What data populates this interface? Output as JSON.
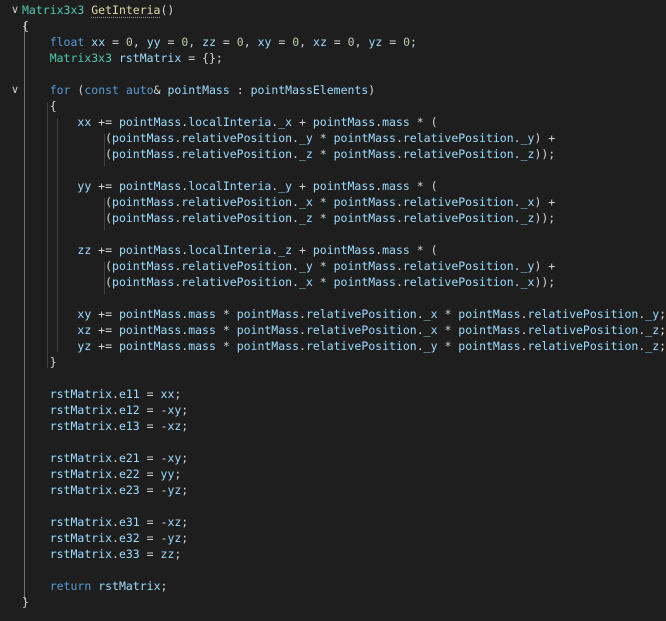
{
  "colors": {
    "background": "#1e1e1e",
    "keyword": "#569cd6",
    "type": "#4ec9b0",
    "function": "#dcdcaa",
    "variable": "#9cdcfe",
    "number": "#b5cea8",
    "text": "#d4d4d4"
  },
  "icons": {
    "fold": "chevron-down-icon"
  },
  "lines": [
    {
      "fold": true,
      "tokens": [
        [
          "ty",
          "Matrix3x3"
        ],
        [
          "op",
          " "
        ],
        [
          "fn",
          "GetInteria"
        ],
        [
          "op",
          "()"
        ]
      ]
    },
    {
      "tokens": [
        [
          "op",
          "{"
        ]
      ]
    },
    {
      "tokens": [
        [
          "op",
          "    "
        ],
        [
          "kw",
          "float"
        ],
        [
          "op",
          " "
        ],
        [
          "var",
          "xx"
        ],
        [
          "op",
          " = "
        ],
        [
          "num",
          "0"
        ],
        [
          "op",
          ", "
        ],
        [
          "var",
          "yy"
        ],
        [
          "op",
          " = "
        ],
        [
          "num",
          "0"
        ],
        [
          "op",
          ", "
        ],
        [
          "var",
          "zz"
        ],
        [
          "op",
          " = "
        ],
        [
          "num",
          "0"
        ],
        [
          "op",
          ", "
        ],
        [
          "var",
          "xy"
        ],
        [
          "op",
          " = "
        ],
        [
          "num",
          "0"
        ],
        [
          "op",
          ", "
        ],
        [
          "var",
          "xz"
        ],
        [
          "op",
          " = "
        ],
        [
          "num",
          "0"
        ],
        [
          "op",
          ", "
        ],
        [
          "var",
          "yz"
        ],
        [
          "op",
          " = "
        ],
        [
          "num",
          "0"
        ],
        [
          "op",
          ";"
        ]
      ]
    },
    {
      "tokens": [
        [
          "op",
          "    "
        ],
        [
          "ty",
          "Matrix3x3"
        ],
        [
          "op",
          " "
        ],
        [
          "var",
          "rstMatrix"
        ],
        [
          "op",
          " = {};"
        ]
      ]
    },
    {
      "tokens": []
    },
    {
      "fold": true,
      "tokens": [
        [
          "op",
          "    "
        ],
        [
          "kw",
          "for"
        ],
        [
          "op",
          " ("
        ],
        [
          "kw",
          "const"
        ],
        [
          "op",
          " "
        ],
        [
          "kw",
          "auto"
        ],
        [
          "op",
          "& "
        ],
        [
          "var",
          "pointMass"
        ],
        [
          "op",
          " : "
        ],
        [
          "var",
          "pointMassElements"
        ],
        [
          "op",
          ")"
        ]
      ]
    },
    {
      "tokens": [
        [
          "op",
          "    {"
        ]
      ]
    },
    {
      "tokens": [
        [
          "op",
          "        "
        ],
        [
          "var",
          "xx"
        ],
        [
          "op",
          " += "
        ],
        [
          "var",
          "pointMass"
        ],
        [
          "op",
          "."
        ],
        [
          "var",
          "localInteria"
        ],
        [
          "op",
          "."
        ],
        [
          "var",
          "_x"
        ],
        [
          "op",
          " + "
        ],
        [
          "var",
          "pointMass"
        ],
        [
          "op",
          "."
        ],
        [
          "var",
          "mass"
        ],
        [
          "op",
          " * ("
        ]
      ]
    },
    {
      "tokens": [
        [
          "op",
          "            ("
        ],
        [
          "var",
          "pointMass"
        ],
        [
          "op",
          "."
        ],
        [
          "var",
          "relativePosition"
        ],
        [
          "op",
          "."
        ],
        [
          "var",
          "_y"
        ],
        [
          "op",
          " * "
        ],
        [
          "var",
          "pointMass"
        ],
        [
          "op",
          "."
        ],
        [
          "var",
          "relativePosition"
        ],
        [
          "op",
          "."
        ],
        [
          "var",
          "_y"
        ],
        [
          "op",
          ") +"
        ]
      ]
    },
    {
      "tokens": [
        [
          "op",
          "            ("
        ],
        [
          "var",
          "pointMass"
        ],
        [
          "op",
          "."
        ],
        [
          "var",
          "relativePosition"
        ],
        [
          "op",
          "."
        ],
        [
          "var",
          "_z"
        ],
        [
          "op",
          " * "
        ],
        [
          "var",
          "pointMass"
        ],
        [
          "op",
          "."
        ],
        [
          "var",
          "relativePosition"
        ],
        [
          "op",
          "."
        ],
        [
          "var",
          "_z"
        ],
        [
          "op",
          "));"
        ]
      ]
    },
    {
      "tokens": []
    },
    {
      "tokens": [
        [
          "op",
          "        "
        ],
        [
          "var",
          "yy"
        ],
        [
          "op",
          " += "
        ],
        [
          "var",
          "pointMass"
        ],
        [
          "op",
          "."
        ],
        [
          "var",
          "localInteria"
        ],
        [
          "op",
          "."
        ],
        [
          "var",
          "_y"
        ],
        [
          "op",
          " + "
        ],
        [
          "var",
          "pointMass"
        ],
        [
          "op",
          "."
        ],
        [
          "var",
          "mass"
        ],
        [
          "op",
          " * ("
        ]
      ]
    },
    {
      "tokens": [
        [
          "op",
          "            ("
        ],
        [
          "var",
          "pointMass"
        ],
        [
          "op",
          "."
        ],
        [
          "var",
          "relativePosition"
        ],
        [
          "op",
          "."
        ],
        [
          "var",
          "_x"
        ],
        [
          "op",
          " * "
        ],
        [
          "var",
          "pointMass"
        ],
        [
          "op",
          "."
        ],
        [
          "var",
          "relativePosition"
        ],
        [
          "op",
          "."
        ],
        [
          "var",
          "_x"
        ],
        [
          "op",
          ") +"
        ]
      ]
    },
    {
      "tokens": [
        [
          "op",
          "            ("
        ],
        [
          "var",
          "pointMass"
        ],
        [
          "op",
          "."
        ],
        [
          "var",
          "relativePosition"
        ],
        [
          "op",
          "."
        ],
        [
          "var",
          "_z"
        ],
        [
          "op",
          " * "
        ],
        [
          "var",
          "pointMass"
        ],
        [
          "op",
          "."
        ],
        [
          "var",
          "relativePosition"
        ],
        [
          "op",
          "."
        ],
        [
          "var",
          "_z"
        ],
        [
          "op",
          "));"
        ]
      ]
    },
    {
      "tokens": []
    },
    {
      "tokens": [
        [
          "op",
          "        "
        ],
        [
          "var",
          "zz"
        ],
        [
          "op",
          " += "
        ],
        [
          "var",
          "pointMass"
        ],
        [
          "op",
          "."
        ],
        [
          "var",
          "localInteria"
        ],
        [
          "op",
          "."
        ],
        [
          "var",
          "_z"
        ],
        [
          "op",
          " + "
        ],
        [
          "var",
          "pointMass"
        ],
        [
          "op",
          "."
        ],
        [
          "var",
          "mass"
        ],
        [
          "op",
          " * ("
        ]
      ]
    },
    {
      "tokens": [
        [
          "op",
          "            ("
        ],
        [
          "var",
          "pointMass"
        ],
        [
          "op",
          "."
        ],
        [
          "var",
          "relativePosition"
        ],
        [
          "op",
          "."
        ],
        [
          "var",
          "_y"
        ],
        [
          "op",
          " * "
        ],
        [
          "var",
          "pointMass"
        ],
        [
          "op",
          "."
        ],
        [
          "var",
          "relativePosition"
        ],
        [
          "op",
          "."
        ],
        [
          "var",
          "_y"
        ],
        [
          "op",
          ") +"
        ]
      ]
    },
    {
      "tokens": [
        [
          "op",
          "            ("
        ],
        [
          "var",
          "pointMass"
        ],
        [
          "op",
          "."
        ],
        [
          "var",
          "relativePosition"
        ],
        [
          "op",
          "."
        ],
        [
          "var",
          "_x"
        ],
        [
          "op",
          " * "
        ],
        [
          "var",
          "pointMass"
        ],
        [
          "op",
          "."
        ],
        [
          "var",
          "relativePosition"
        ],
        [
          "op",
          "."
        ],
        [
          "var",
          "_x"
        ],
        [
          "op",
          "));"
        ]
      ]
    },
    {
      "tokens": []
    },
    {
      "tokens": [
        [
          "op",
          "        "
        ],
        [
          "var",
          "xy"
        ],
        [
          "op",
          " += "
        ],
        [
          "var",
          "pointMass"
        ],
        [
          "op",
          "."
        ],
        [
          "var",
          "mass"
        ],
        [
          "op",
          " * "
        ],
        [
          "var",
          "pointMass"
        ],
        [
          "op",
          "."
        ],
        [
          "var",
          "relativePosition"
        ],
        [
          "op",
          "."
        ],
        [
          "var",
          "_x"
        ],
        [
          "op",
          " * "
        ],
        [
          "var",
          "pointMass"
        ],
        [
          "op",
          "."
        ],
        [
          "var",
          "relativePosition"
        ],
        [
          "op",
          "."
        ],
        [
          "var",
          "_y"
        ],
        [
          "op",
          ";"
        ]
      ]
    },
    {
      "tokens": [
        [
          "op",
          "        "
        ],
        [
          "var",
          "xz"
        ],
        [
          "op",
          " += "
        ],
        [
          "var",
          "pointMass"
        ],
        [
          "op",
          "."
        ],
        [
          "var",
          "mass"
        ],
        [
          "op",
          " * "
        ],
        [
          "var",
          "pointMass"
        ],
        [
          "op",
          "."
        ],
        [
          "var",
          "relativePosition"
        ],
        [
          "op",
          "."
        ],
        [
          "var",
          "_x"
        ],
        [
          "op",
          " * "
        ],
        [
          "var",
          "pointMass"
        ],
        [
          "op",
          "."
        ],
        [
          "var",
          "relativePosition"
        ],
        [
          "op",
          "."
        ],
        [
          "var",
          "_z"
        ],
        [
          "op",
          ";"
        ]
      ]
    },
    {
      "tokens": [
        [
          "op",
          "        "
        ],
        [
          "var",
          "yz"
        ],
        [
          "op",
          " += "
        ],
        [
          "var",
          "pointMass"
        ],
        [
          "op",
          "."
        ],
        [
          "var",
          "mass"
        ],
        [
          "op",
          " * "
        ],
        [
          "var",
          "pointMass"
        ],
        [
          "op",
          "."
        ],
        [
          "var",
          "relativePosition"
        ],
        [
          "op",
          "."
        ],
        [
          "var",
          "_y"
        ],
        [
          "op",
          " * "
        ],
        [
          "var",
          "pointMass"
        ],
        [
          "op",
          "."
        ],
        [
          "var",
          "relativePosition"
        ],
        [
          "op",
          "."
        ],
        [
          "var",
          "_z"
        ],
        [
          "op",
          ";"
        ]
      ]
    },
    {
      "tokens": [
        [
          "op",
          "    }"
        ]
      ]
    },
    {
      "tokens": []
    },
    {
      "tokens": [
        [
          "op",
          "    "
        ],
        [
          "var",
          "rstMatrix"
        ],
        [
          "op",
          "."
        ],
        [
          "var",
          "e11"
        ],
        [
          "op",
          " = "
        ],
        [
          "var",
          "xx"
        ],
        [
          "op",
          ";"
        ]
      ]
    },
    {
      "tokens": [
        [
          "op",
          "    "
        ],
        [
          "var",
          "rstMatrix"
        ],
        [
          "op",
          "."
        ],
        [
          "var",
          "e12"
        ],
        [
          "op",
          " = -"
        ],
        [
          "var",
          "xy"
        ],
        [
          "op",
          ";"
        ]
      ]
    },
    {
      "tokens": [
        [
          "op",
          "    "
        ],
        [
          "var",
          "rstMatrix"
        ],
        [
          "op",
          "."
        ],
        [
          "var",
          "e13"
        ],
        [
          "op",
          " = -"
        ],
        [
          "var",
          "xz"
        ],
        [
          "op",
          ";"
        ]
      ]
    },
    {
      "tokens": []
    },
    {
      "tokens": [
        [
          "op",
          "    "
        ],
        [
          "var",
          "rstMatrix"
        ],
        [
          "op",
          "."
        ],
        [
          "var",
          "e21"
        ],
        [
          "op",
          " = -"
        ],
        [
          "var",
          "xy"
        ],
        [
          "op",
          ";"
        ]
      ]
    },
    {
      "tokens": [
        [
          "op",
          "    "
        ],
        [
          "var",
          "rstMatrix"
        ],
        [
          "op",
          "."
        ],
        [
          "var",
          "e22"
        ],
        [
          "op",
          " = "
        ],
        [
          "var",
          "yy"
        ],
        [
          "op",
          ";"
        ]
      ]
    },
    {
      "tokens": [
        [
          "op",
          "    "
        ],
        [
          "var",
          "rstMatrix"
        ],
        [
          "op",
          "."
        ],
        [
          "var",
          "e23"
        ],
        [
          "op",
          " = -"
        ],
        [
          "var",
          "yz"
        ],
        [
          "op",
          ";"
        ]
      ]
    },
    {
      "tokens": []
    },
    {
      "tokens": [
        [
          "op",
          "    "
        ],
        [
          "var",
          "rstMatrix"
        ],
        [
          "op",
          "."
        ],
        [
          "var",
          "e31"
        ],
        [
          "op",
          " = -"
        ],
        [
          "var",
          "xz"
        ],
        [
          "op",
          ";"
        ]
      ]
    },
    {
      "tokens": [
        [
          "op",
          "    "
        ],
        [
          "var",
          "rstMatrix"
        ],
        [
          "op",
          "."
        ],
        [
          "var",
          "e32"
        ],
        [
          "op",
          " = -"
        ],
        [
          "var",
          "yz"
        ],
        [
          "op",
          ";"
        ]
      ]
    },
    {
      "tokens": [
        [
          "op",
          "    "
        ],
        [
          "var",
          "rstMatrix"
        ],
        [
          "op",
          "."
        ],
        [
          "var",
          "e33"
        ],
        [
          "op",
          " = "
        ],
        [
          "var",
          "zz"
        ],
        [
          "op",
          ";"
        ]
      ]
    },
    {
      "tokens": []
    },
    {
      "tokens": [
        [
          "op",
          "    "
        ],
        [
          "kw",
          "return"
        ],
        [
          "op",
          " "
        ],
        [
          "var",
          "rstMatrix"
        ],
        [
          "op",
          ";"
        ]
      ]
    },
    {
      "tokens": [
        [
          "op",
          "}"
        ]
      ]
    }
  ]
}
